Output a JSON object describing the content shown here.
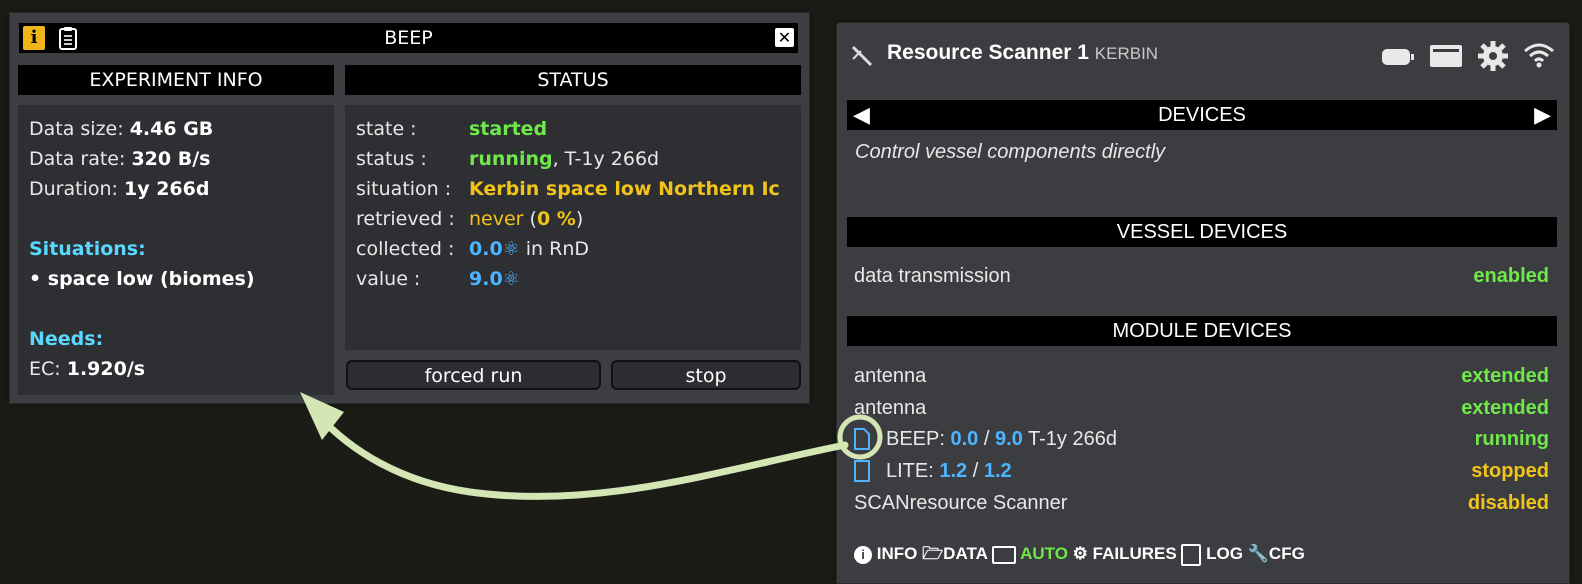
{
  "beep": {
    "title": "BEEP",
    "info_header": "EXPERIMENT INFO",
    "status_header": "STATUS",
    "info": {
      "data_size_label": "Data size:",
      "data_size": "4.46 GB",
      "data_rate_label": "Data rate:",
      "data_rate": "320 B/s",
      "duration_label": "Duration:",
      "duration": "1y 266d",
      "situations_label": "Situations:",
      "situation_item": "• space low (biomes)",
      "needs_label": "Needs:",
      "ec_label": "EC:",
      "ec_value": "1.920/s"
    },
    "status": {
      "state_label": "state :",
      "state": "started",
      "status_label": "status :",
      "status_value": "running",
      "status_time": ", T-1y 266d",
      "situation_label": "situation :",
      "situation": "Kerbin space low Northern Ic",
      "retrieved_label": "retrieved :",
      "retrieved": "never",
      "retrieved_open": " (",
      "retrieved_pct": "0 %",
      "retrieved_close": ")",
      "collected_label": "collected :",
      "collected": "0.0",
      "collected_suffix": " in RnD",
      "value_label": "value :",
      "value": "9.0"
    },
    "buttons": {
      "forced_run": "forced run",
      "stop": "stop"
    }
  },
  "scanner": {
    "title": "Resource Scanner 1",
    "body": "KERBIN",
    "devices_header": "DEVICES",
    "devices_desc": "Control vessel components directly",
    "vessel_header": "VESSEL DEVICES",
    "vessel_items": [
      {
        "name": "data transmission",
        "state": "enabled"
      }
    ],
    "module_header": "MODULE DEVICES",
    "modules": {
      "antenna1": {
        "name": "antenna",
        "state": "extended"
      },
      "antenna2": {
        "name": "antenna",
        "state": "extended"
      },
      "beep": {
        "name": "BEEP:",
        "a": "0.0",
        "sep": "/",
        "b": "9.0",
        "extra": "T-1y 266d",
        "state": "running"
      },
      "lite": {
        "name": "LITE:",
        "a": "1.2",
        "sep": "/",
        "b": "1.2",
        "state": "stopped"
      },
      "scan": {
        "name": "SCANresource Scanner",
        "state": "disabled"
      }
    },
    "footer": {
      "info": "INFO",
      "data": "DATA",
      "auto": "AUTO",
      "failures": "FAILURES",
      "log": "LOG",
      "cfg": "CFG"
    }
  },
  "colors": {
    "green": "#6fe84a",
    "yellow": "#f2c318",
    "cyan": "#5ad8ff",
    "blue": "#4db5ff",
    "arrow": "#d3e6b4"
  }
}
